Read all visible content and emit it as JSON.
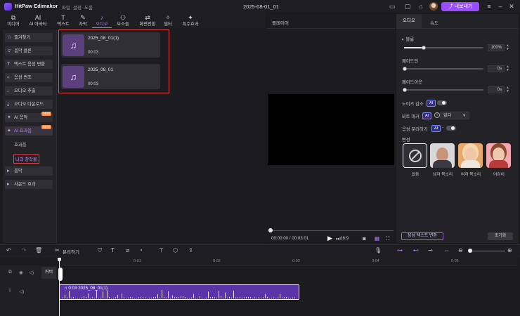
{
  "titlebar": {
    "app_name": "HitPaw Edimakor",
    "menu": [
      "파일",
      "설정",
      "도움"
    ],
    "document_title": "2025-08-01_01",
    "export_label": "내보내기"
  },
  "toolbar_tabs": [
    {
      "icon": "media-icon",
      "glyph": "⧉",
      "label": "미디어"
    },
    {
      "icon": "ai-avatar-icon",
      "glyph": "AI",
      "label": "AI 아바타"
    },
    {
      "icon": "text-icon",
      "glyph": "T",
      "label": "텍스트"
    },
    {
      "icon": "subtitle-icon",
      "glyph": "✎",
      "label": "자막"
    },
    {
      "icon": "audio-icon",
      "glyph": "♪",
      "label": "오디오"
    },
    {
      "icon": "elements-icon",
      "glyph": "⚇",
      "label": "요소들"
    },
    {
      "icon": "transition-icon",
      "glyph": "⇄",
      "label": "화면전환"
    },
    {
      "icon": "filter-icon",
      "glyph": "✧",
      "label": "필터"
    },
    {
      "icon": "effects-icon",
      "glyph": "✦",
      "label": "특수효과"
    }
  ],
  "active_tab": "오디오",
  "sidebar": {
    "items": [
      {
        "icon": "star-icon",
        "glyph": "☆",
        "label": "즐겨찾기"
      },
      {
        "icon": "music-library-icon",
        "glyph": "♫",
        "label": "음악 클론"
      },
      {
        "icon": "tts-icon",
        "glyph": "T",
        "label": "텍스트 음성 변환"
      },
      {
        "icon": "voice-change-icon",
        "glyph": "◐",
        "label": "음성 변조"
      },
      {
        "icon": "mic-icon",
        "glyph": "🎙",
        "label": "오디오 추출"
      },
      {
        "icon": "download-icon",
        "glyph": "⤓",
        "label": "오디오 다운로드"
      },
      {
        "icon": "ai-music-icon",
        "glyph": "✦",
        "label": "AI 음악",
        "badge": "NEW"
      },
      {
        "icon": "ai-sfx-icon",
        "glyph": "✦",
        "label": "AI 효과음",
        "badge": "NEW"
      }
    ],
    "sub_items": [
      "효과음",
      "나의 창작물"
    ],
    "collapsed": [
      {
        "icon": "chevron-right-icon",
        "glyph": "▸",
        "label": "음악"
      },
      {
        "icon": "chevron-right-icon",
        "glyph": "▸",
        "label": "사운드 효과"
      }
    ]
  },
  "media": [
    {
      "name": "2025_08_01(1)",
      "duration": "00:03"
    },
    {
      "name": "2025_08_01",
      "duration": "00:03"
    }
  ],
  "player": {
    "title": "플레이어",
    "time": "00:00:00 / 00:03:01",
    "aspect": "16:9",
    "progress": 0
  },
  "right_panel": {
    "tabs": [
      "오디오",
      "속도"
    ],
    "volume": {
      "label": "볼륨",
      "value": "100%",
      "fraction": 0.25
    },
    "fade_in": {
      "label": "페이드인",
      "value": "0s",
      "fraction": 0
    },
    "fade_out": {
      "label": "페이드아웃",
      "value": "0s",
      "fraction": 0
    },
    "noise_reduction": {
      "label": "노이즈 감소",
      "chip": "AI"
    },
    "beat_marker": {
      "label": "비트 마커",
      "chip": "AI",
      "info": "i",
      "selected": "없다"
    },
    "voice_separation": {
      "label": "음성 분리하기",
      "chip": "AI",
      "dash": "-"
    },
    "voice_change_title": "변성",
    "voices": [
      "없음",
      "남자 목소리",
      "여자 목소리",
      "어린이"
    ],
    "voice_to_text": "음성 텍스트 변환",
    "reset": "초기화"
  },
  "edit_toolbar": {
    "split_label": "분리하기"
  },
  "timeline": {
    "ruler": [
      "0:01",
      "0:02",
      "0:03",
      "0:04",
      "0:05"
    ],
    "cover_label": "커버",
    "clip_label": "0:03 2025_08_01(1)"
  },
  "colors": {
    "accent": "#9a4dff",
    "highlight": "#e24a4a",
    "clip": "#5a34a8"
  }
}
